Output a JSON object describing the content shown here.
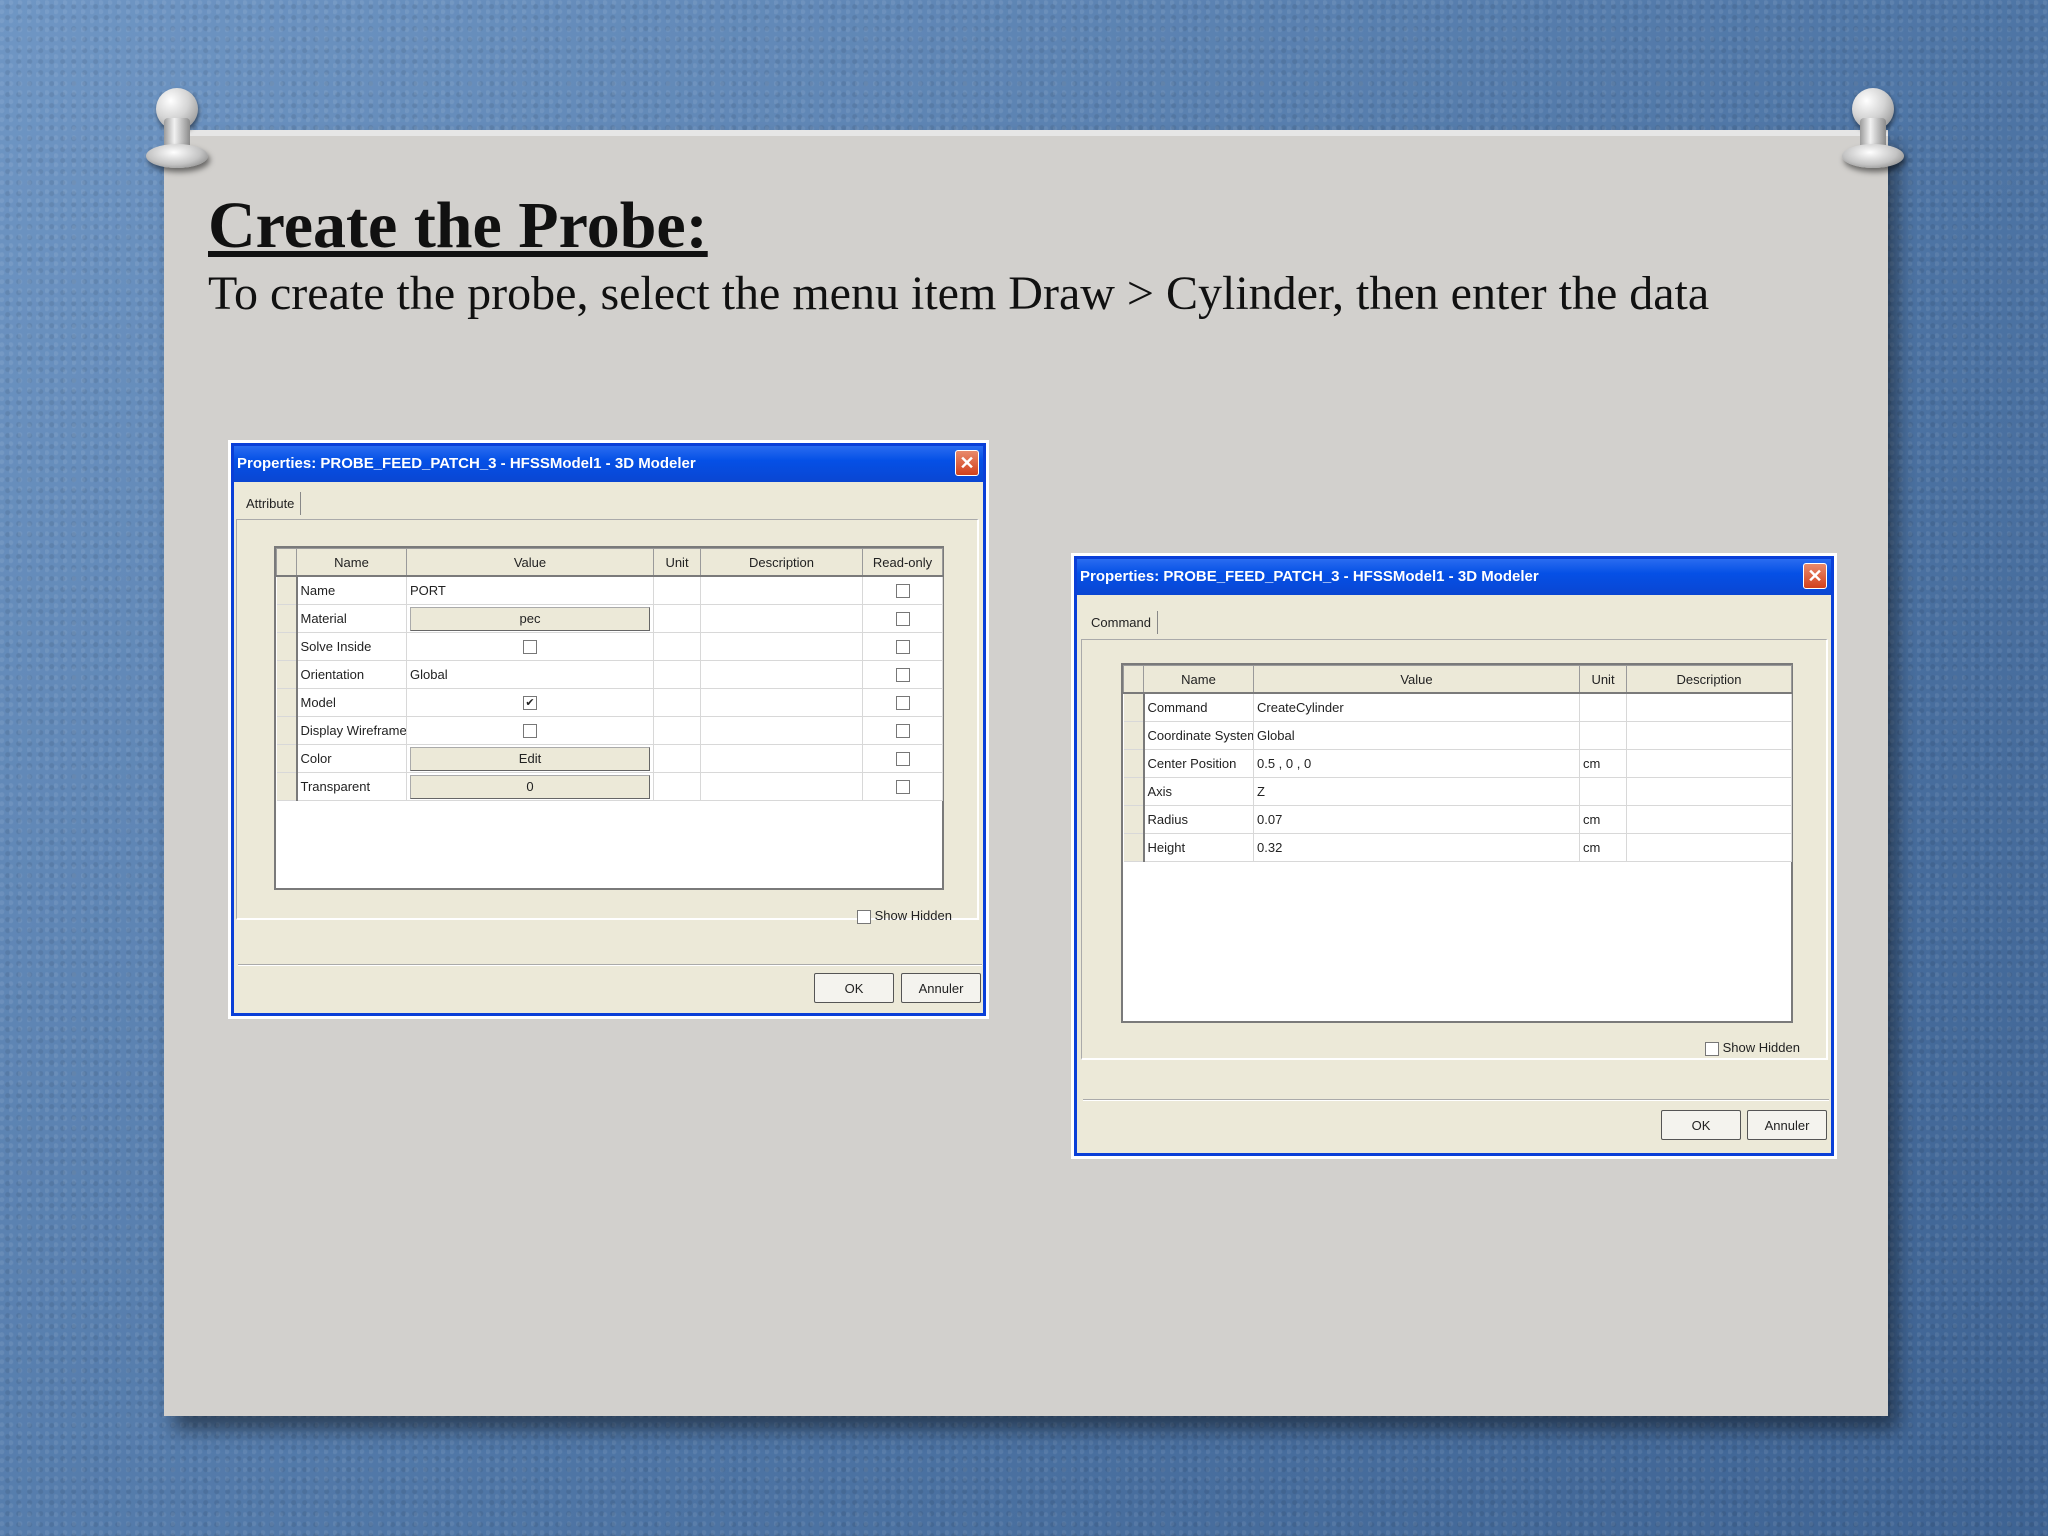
{
  "slide": {
    "title": "Create the Probe:",
    "subtitle": "To create the probe, select the menu item Draw > Cylinder, then enter the data"
  },
  "dialog1": {
    "title": "Properties: PROBE_FEED_PATCH_3 - HFSSModel1 - 3D Modeler",
    "tab": "Attribute",
    "columns": [
      "Name",
      "Value",
      "Unit",
      "Description",
      "Read-only"
    ],
    "rows": [
      {
        "name": "Name",
        "value": "PORT"
      },
      {
        "name": "Material",
        "value": "pec"
      },
      {
        "name": "Solve Inside",
        "value": ""
      },
      {
        "name": "Orientation",
        "value": "Global"
      },
      {
        "name": "Model",
        "value": ""
      },
      {
        "name": "Display Wireframe",
        "value": ""
      },
      {
        "name": "Color",
        "value": "Edit"
      },
      {
        "name": "Transparent",
        "value": "0"
      }
    ],
    "checkboxes": {
      "solve_inside": false,
      "model": true,
      "display_wireframe": false
    },
    "show_hidden": "Show Hidden",
    "ok": "OK",
    "cancel": "Annuler"
  },
  "dialog2": {
    "title": "Properties: PROBE_FEED_PATCH_3 - HFSSModel1 - 3D Modeler",
    "tab": "Command",
    "columns": [
      "Name",
      "Value",
      "Unit",
      "Description"
    ],
    "rows": [
      {
        "name": "Command",
        "value": "CreateCylinder",
        "unit": ""
      },
      {
        "name": "Coordinate System",
        "value": "Global",
        "unit": ""
      },
      {
        "name": "Center Position",
        "value": "0.5 , 0 , 0",
        "unit": "cm"
      },
      {
        "name": "Axis",
        "value": "Z",
        "unit": ""
      },
      {
        "name": "Radius",
        "value": "0.07",
        "unit": "cm"
      },
      {
        "name": "Height",
        "value": "0.32",
        "unit": "cm"
      }
    ],
    "show_hidden": "Show Hidden",
    "ok": "OK",
    "cancel": "Annuler"
  },
  "colors": {
    "background": "#5f86b4",
    "paper": "#d2d0cd",
    "titlebar": "#0550e6",
    "dialog": "#ece9d8"
  },
  "icons": {
    "close": "close-icon",
    "pin": "pushpin-icon",
    "check": "checkmark-icon"
  }
}
